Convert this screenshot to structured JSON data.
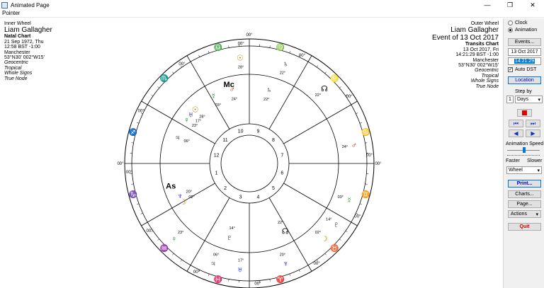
{
  "window": {
    "title": "Animated Page",
    "minimize": "—",
    "maximize": "❐",
    "close": "✕"
  },
  "menu": {
    "item": "Pointer"
  },
  "inner": {
    "label": "Inner Wheel",
    "name": "Liam Gallagher",
    "chart": "Natal Chart",
    "date": "21 Sep 1972, Thu",
    "time": "12:58  BST -1:00",
    "place": "Manchester",
    "coords": "53°N30' 002°W15'",
    "z1": "Geocentric",
    "z2": "Tropical",
    "z3": "Whole Signs",
    "z4": "True Node"
  },
  "outer": {
    "label": "Outer Wheel",
    "name": "Liam Gallagher",
    "event": "Event of 13 Oct 2017",
    "chart": "Transits Chart",
    "date": "13 Oct 2017, Fri",
    "time": "14:21:29  BST -1:00",
    "place": "Manchester",
    "coords": "53°N30' 002°W15'",
    "z1": "Geocentric",
    "z2": "Tropical",
    "z3": "Whole Signs",
    "z4": "True Node"
  },
  "panel": {
    "clock": "Clock",
    "animation": "Animation",
    "events": "Events...",
    "date_value": "13 Oct 2017",
    "time_value": "14:21:29",
    "auto_dst": "Auto DST",
    "location": "Location",
    "step_by": "Step by",
    "step_num": "1",
    "step_unit": "Days",
    "anim_speed": "Animation Speed",
    "faster": "Faster",
    "slower": "Slower",
    "wheel": "Wheel",
    "print": "Print...",
    "charts": "Charts...",
    "page": "Page...",
    "actions": "Actions",
    "quit": "Quit"
  },
  "wheel": {
    "houses": [
      "1",
      "2",
      "3",
      "4",
      "5",
      "6",
      "7",
      "8",
      "9",
      "10",
      "11",
      "12"
    ],
    "cusp_degree": "00°",
    "asc": "As",
    "mc": "Mc",
    "signs": [
      {
        "glyph": "♈",
        "color": "#cc0000"
      },
      {
        "glyph": "♉",
        "color": "#008800"
      },
      {
        "glyph": "♊",
        "color": "#0077aa"
      },
      {
        "glyph": "♋",
        "color": "#0000cc"
      },
      {
        "glyph": "♌",
        "color": "#cc0000"
      },
      {
        "glyph": "♍",
        "color": "#008800"
      },
      {
        "glyph": "♎",
        "color": "#0077aa"
      },
      {
        "glyph": "♏",
        "color": "#0000cc"
      },
      {
        "glyph": "♐",
        "color": "#cc0000"
      },
      {
        "glyph": "♑",
        "color": "#008800"
      },
      {
        "glyph": "♒",
        "color": "#0077aa"
      },
      {
        "glyph": "♓",
        "color": "#0000cc"
      }
    ],
    "planets": [
      {
        "glyph": "☿",
        "deg": "03°",
        "color": "#008800"
      },
      {
        "glyph": "♂",
        "deg": "24°",
        "color": "#cc0000"
      },
      {
        "glyph": "♄",
        "deg": "22°",
        "color": "#000000"
      },
      {
        "glyph": "☉",
        "deg": "28°",
        "color": "#aa8800"
      },
      {
        "glyph": "♀",
        "deg": "23°",
        "color": "#008800"
      },
      {
        "glyph": "♃",
        "deg": "06°",
        "color": "#000000"
      },
      {
        "glyph": "♅",
        "deg": "17°",
        "color": "#0000cc"
      },
      {
        "glyph": "♆",
        "deg": "20°",
        "color": "#0000cc"
      },
      {
        "glyph": "☽",
        "deg": "02°",
        "color": "#aa8800"
      },
      {
        "glyph": "♇",
        "deg": "14°",
        "color": "#000000"
      },
      {
        "glyph": "☊",
        "deg": "22°",
        "color": "#000000"
      }
    ]
  }
}
